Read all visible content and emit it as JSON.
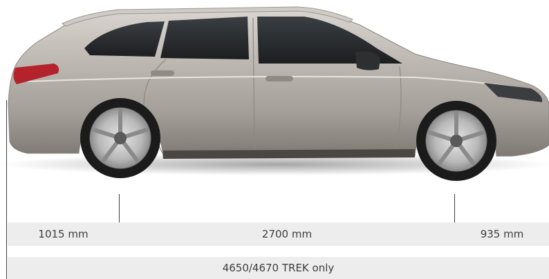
{
  "dimensions": {
    "rear_overhang": "1015 mm",
    "wheelbase": "2700 mm",
    "front_overhang": "935 mm",
    "total_length": "4650/4670 TREK only"
  },
  "colors": {
    "body_paint": "#b4afa8",
    "window_glass": "#2a2c2f",
    "tyre": "#1c1c1c",
    "band_background": "#ededed",
    "dimension_line": "#3c3c3c",
    "label_text": "#3d3d3d"
  }
}
